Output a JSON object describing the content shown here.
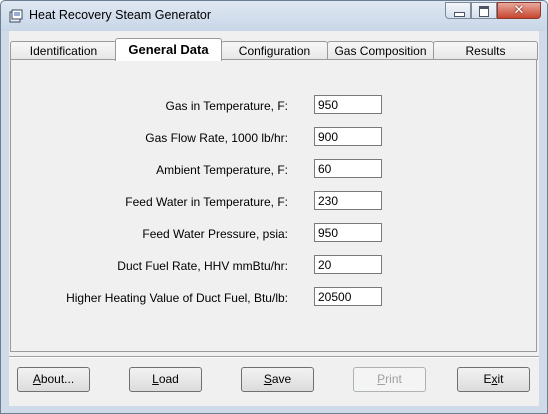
{
  "window": {
    "title": "Heat Recovery Steam Generator"
  },
  "tabs": [
    {
      "label": "Identification",
      "active": false
    },
    {
      "label": "General Data",
      "active": true
    },
    {
      "label": "Configuration",
      "active": false
    },
    {
      "label": "Gas Composition",
      "active": false
    },
    {
      "label": "Results",
      "active": false
    }
  ],
  "general": {
    "gas_in_temp": {
      "label": "Gas in Temperature, F:",
      "value": "950"
    },
    "gas_flow": {
      "label": "Gas Flow Rate, 1000 lb/hr:",
      "value": "900"
    },
    "ambient_temp": {
      "label": "Ambient Temperature, F:",
      "value": "60"
    },
    "feed_water_temp": {
      "label": "Feed Water in Temperature, F:",
      "value": "230"
    },
    "feed_water_pressure": {
      "label": "Feed Water Pressure, psia:",
      "value": "950"
    },
    "duct_fuel_rate": {
      "label": "Duct Fuel Rate, HHV mmBtu/hr:",
      "value": "20"
    },
    "duct_fuel_hhv": {
      "label": "Higher Heating Value of Duct Fuel, Btu/lb:",
      "value": "20500"
    }
  },
  "buttons": {
    "about": {
      "mnemonic": "A",
      "rest": "bout..."
    },
    "load": {
      "mnemonic": "L",
      "rest": "oad"
    },
    "save": {
      "mnemonic": "S",
      "rest": "ave"
    },
    "print": {
      "mnemonic": "P",
      "rest": "rint",
      "disabled": true
    },
    "exit": {
      "prefix": "E",
      "mnemonic": "x",
      "rest": "it"
    }
  }
}
